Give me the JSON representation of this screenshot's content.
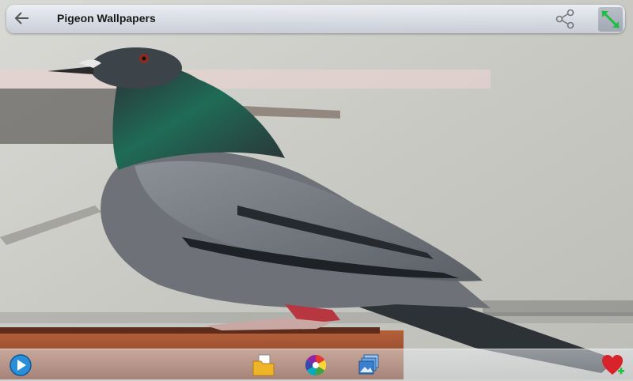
{
  "header": {
    "title": "Pigeon Wallpapers",
    "back_icon": "arrow-left-icon",
    "share_icon": "share-icon",
    "expand_icon": "expand-icon"
  },
  "wallpaper": {
    "subject": "pigeon-photo"
  },
  "bottom_toolbar": {
    "icons": [
      "play-slideshow-icon",
      "folder-save-icon",
      "color-wheel-icon",
      "set-wallpaper-icon",
      "favorite-heart-add-icon"
    ]
  },
  "colors": {
    "accent_green": "#1fbf3f",
    "heart_red": "#d8232a"
  }
}
